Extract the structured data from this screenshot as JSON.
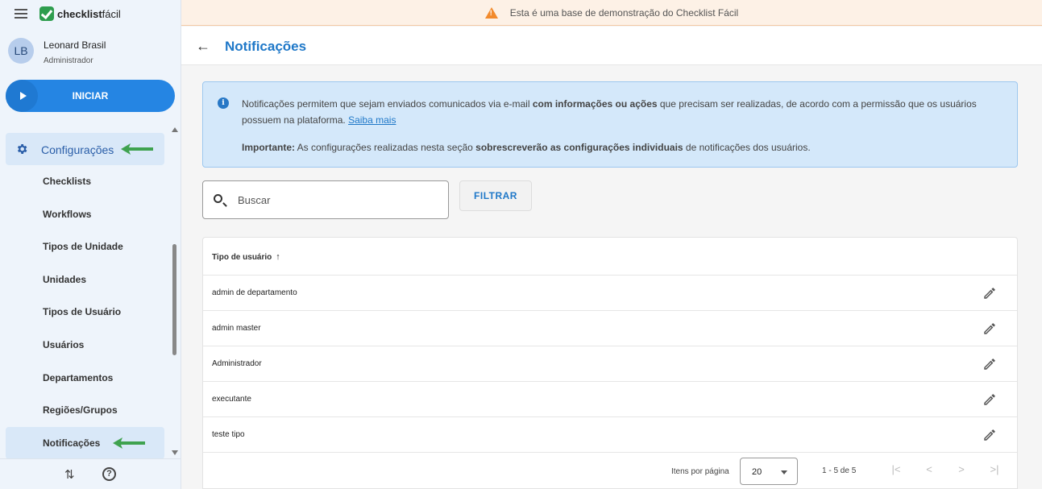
{
  "app": {
    "logo_bold": "checklist",
    "logo_light": "fácil"
  },
  "user": {
    "initials": "LB",
    "name": "Leonard Brasil",
    "role": "Administrador"
  },
  "sidebar": {
    "start_label": "INICIAR",
    "group_label": "Configurações",
    "items": [
      {
        "label": "Checklists"
      },
      {
        "label": "Workflows"
      },
      {
        "label": "Tipos de Unidade"
      },
      {
        "label": "Unidades"
      },
      {
        "label": "Tipos de Usuário"
      },
      {
        "label": "Usuários"
      },
      {
        "label": "Departamentos"
      },
      {
        "label": "Regiões/Grupos"
      },
      {
        "label": "Notificações"
      }
    ],
    "active_item": "Notificações",
    "swap_glyph": "⇅",
    "help_glyph": "?"
  },
  "banner": {
    "text": "Esta é uma base de demonstração do Checklist Fácil"
  },
  "header": {
    "back_glyph": "←",
    "title": "Notificações"
  },
  "info": {
    "p1_start": "Notificações permitem que sejam enviados comunicados via e-mail ",
    "p1_bold": "com informações ou ações",
    "p1_end": " que precisam ser realizadas, de acordo com a permissão que os usuários possuem na plataforma. ",
    "link": "Saiba mais",
    "p2_bold1": "Importante:",
    "p2_mid": " As configurações realizadas nesta seção ",
    "p2_bold2": "sobrescreverão as configurações individuais",
    "p2_end": " de notificações dos usuários."
  },
  "search": {
    "placeholder": "Buscar",
    "value": ""
  },
  "filter_label": "FILTRAR",
  "table": {
    "column": "Tipo de usuário",
    "sort_glyph": "↑",
    "rows": [
      {
        "name": "admin de departamento"
      },
      {
        "name": "admin master"
      },
      {
        "name": "Administrador"
      },
      {
        "name": "executante"
      },
      {
        "name": "teste tipo"
      }
    ]
  },
  "pagination": {
    "items_per_page_label": "Itens por página",
    "page_size": "20",
    "range": "1 - 5 de 5",
    "first_glyph": "|<",
    "prev_glyph": "<",
    "next_glyph": ">",
    "last_glyph": ">|"
  },
  "colors": {
    "accent": "#1f78c8",
    "annotation_arrow": "#3fa24f",
    "banner_warning": "#f28a2c"
  }
}
